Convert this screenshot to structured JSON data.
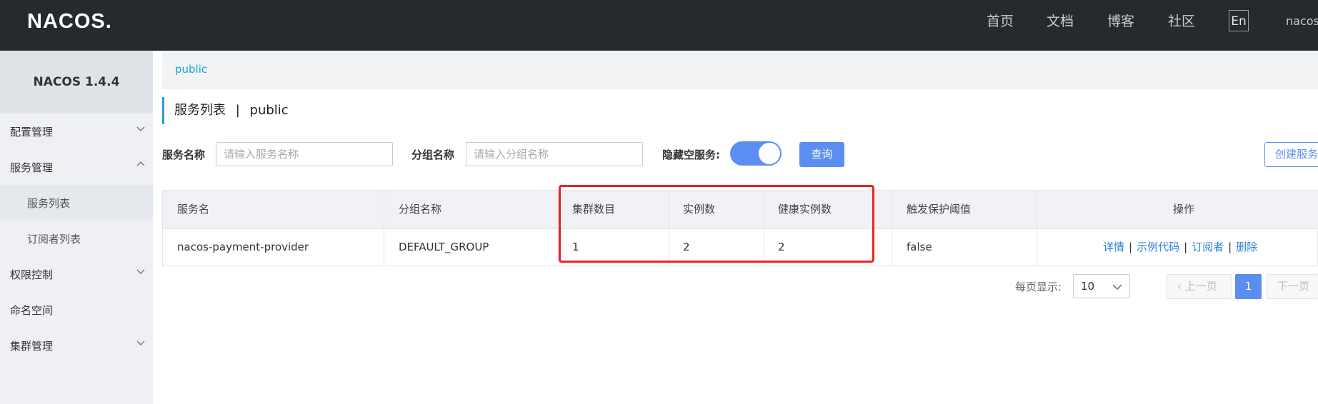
{
  "header": {
    "logo": "NACOS.",
    "nav": [
      "首页",
      "文档",
      "博客",
      "社区"
    ],
    "lang_button": "En",
    "user": "nacos"
  },
  "sidebar": {
    "title": "NACOS 1.4.4",
    "items": [
      {
        "label": "配置管理",
        "chevron": "down"
      },
      {
        "label": "服务管理",
        "chevron": "up"
      },
      {
        "label": "服务列表",
        "sub": true
      },
      {
        "label": "订阅者列表",
        "sub": true
      },
      {
        "label": "权限控制",
        "chevron": "down"
      },
      {
        "label": "命名空间"
      },
      {
        "label": "集群管理",
        "chevron": "down"
      }
    ]
  },
  "breadcrumb": "public",
  "page": {
    "title": "服务列表",
    "separator": "|",
    "namespace": "public"
  },
  "filters": {
    "service_name_label": "服务名称",
    "service_name_placeholder": "请输入服务名称",
    "group_name_label": "分组名称",
    "group_name_placeholder": "请输入分组名称",
    "hide_empty_label": "隐藏空服务:",
    "hide_empty_on": true,
    "query_button": "查询",
    "create_button": "创建服务"
  },
  "table": {
    "headers": [
      "服务名",
      "分组名称",
      "集群数目",
      "实例数",
      "健康实例数",
      "触发保护阈值",
      "操作"
    ],
    "rows": [
      {
        "service": "nacos-payment-provider",
        "group": "DEFAULT_GROUP",
        "clusters": "1",
        "instances": "2",
        "healthy": "2",
        "threshold": "false",
        "ops": [
          "详情",
          "示例代码",
          "订阅者",
          "删除"
        ]
      }
    ]
  },
  "pagination": {
    "per_page_label": "每页显示:",
    "page_size": "10",
    "prev": "上一页",
    "current": "1",
    "next": "下一页"
  },
  "colors": {
    "topbar": "#252a2f",
    "accent": "#5b8ef0",
    "link": "#2a7fd8",
    "highlight": "#e8232a"
  }
}
